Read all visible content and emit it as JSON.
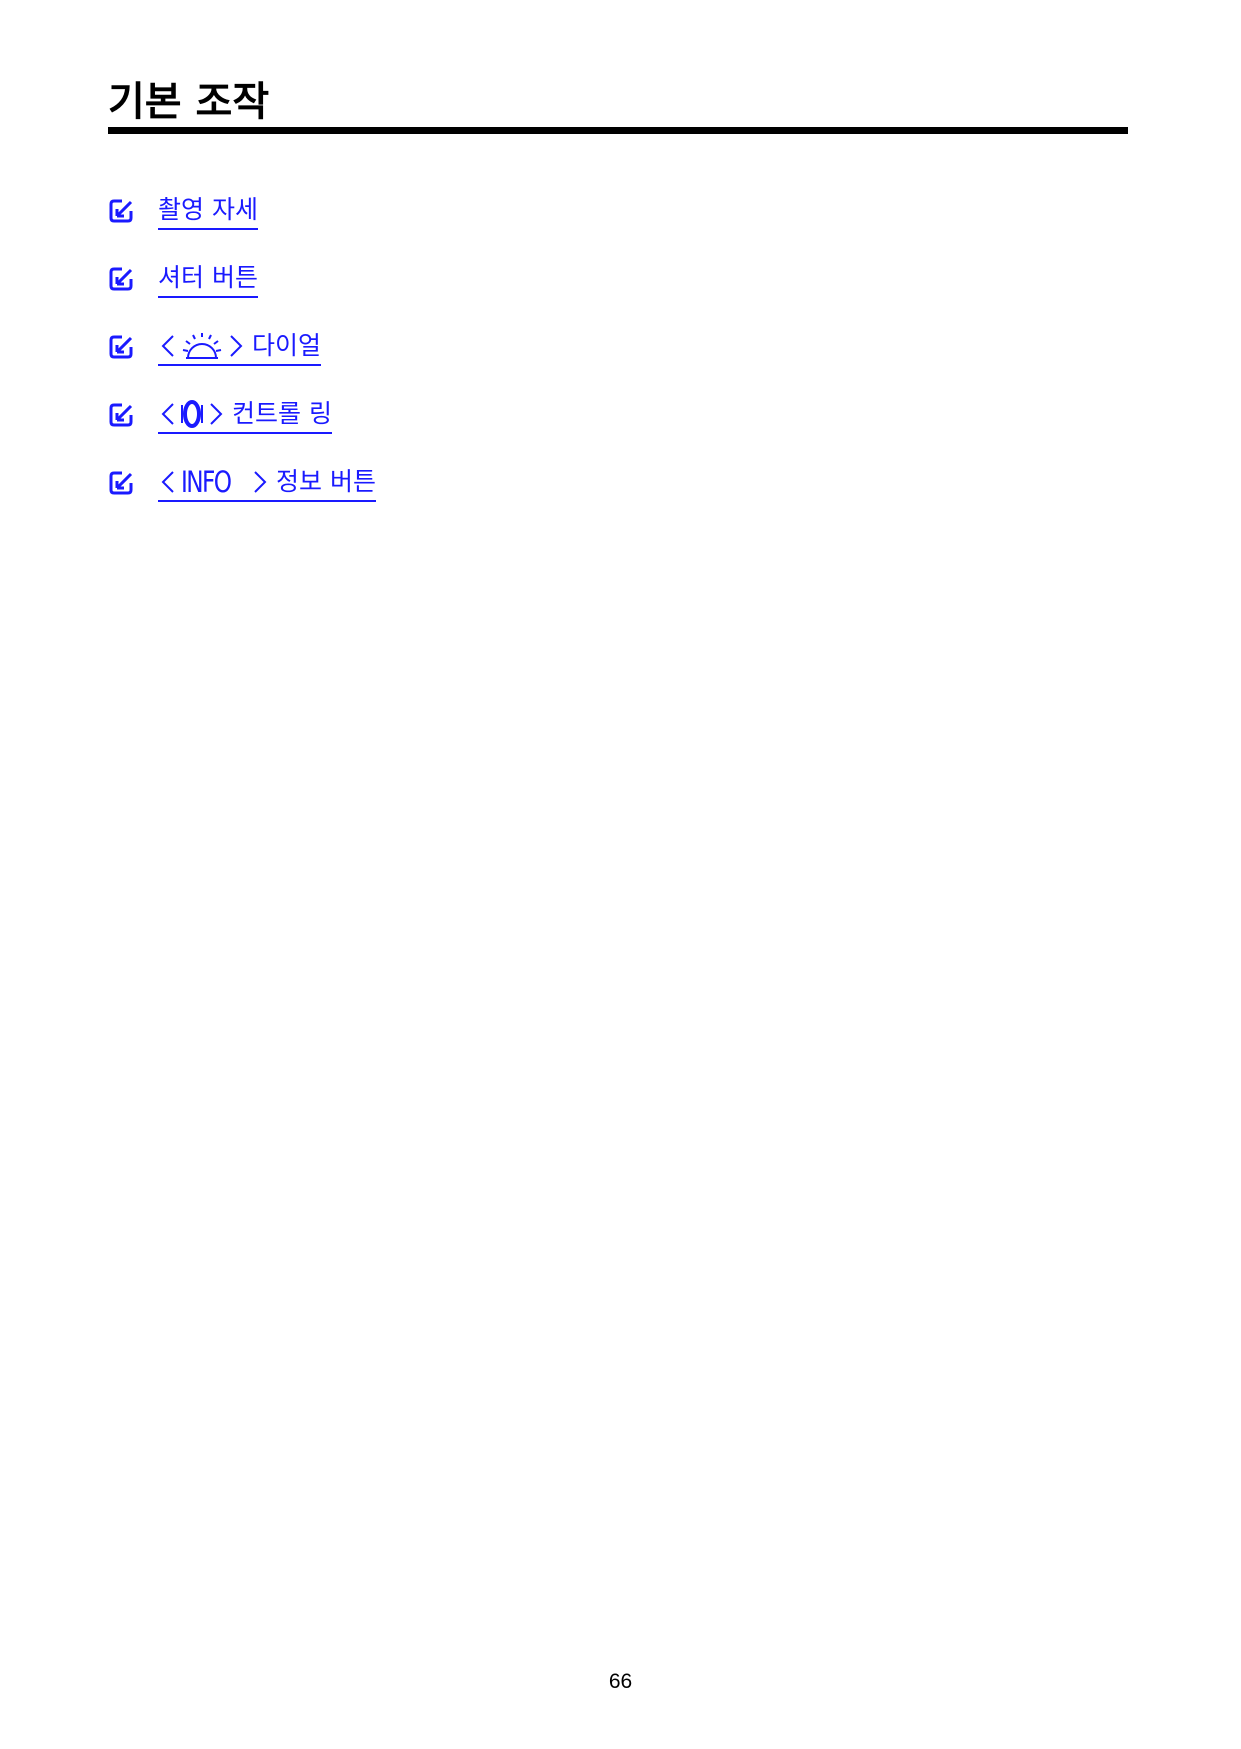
{
  "page": {
    "title": "기본 조작",
    "page_number": "66"
  },
  "links": [
    {
      "text": "촬영 자세",
      "icon": "none"
    },
    {
      "text": "셔터 버튼",
      "icon": "none"
    },
    {
      "text": "다이얼",
      "icon": "main-dial-icon"
    },
    {
      "text": "컨트롤 링",
      "icon": "control-ring-icon"
    },
    {
      "text": "정보 버튼",
      "icon": "info-button",
      "button_label": "INFO"
    }
  ],
  "colors": {
    "link": "#1a1aff",
    "text": "#000000",
    "rule": "#000000"
  },
  "bullet_icon": "check-box-icon"
}
